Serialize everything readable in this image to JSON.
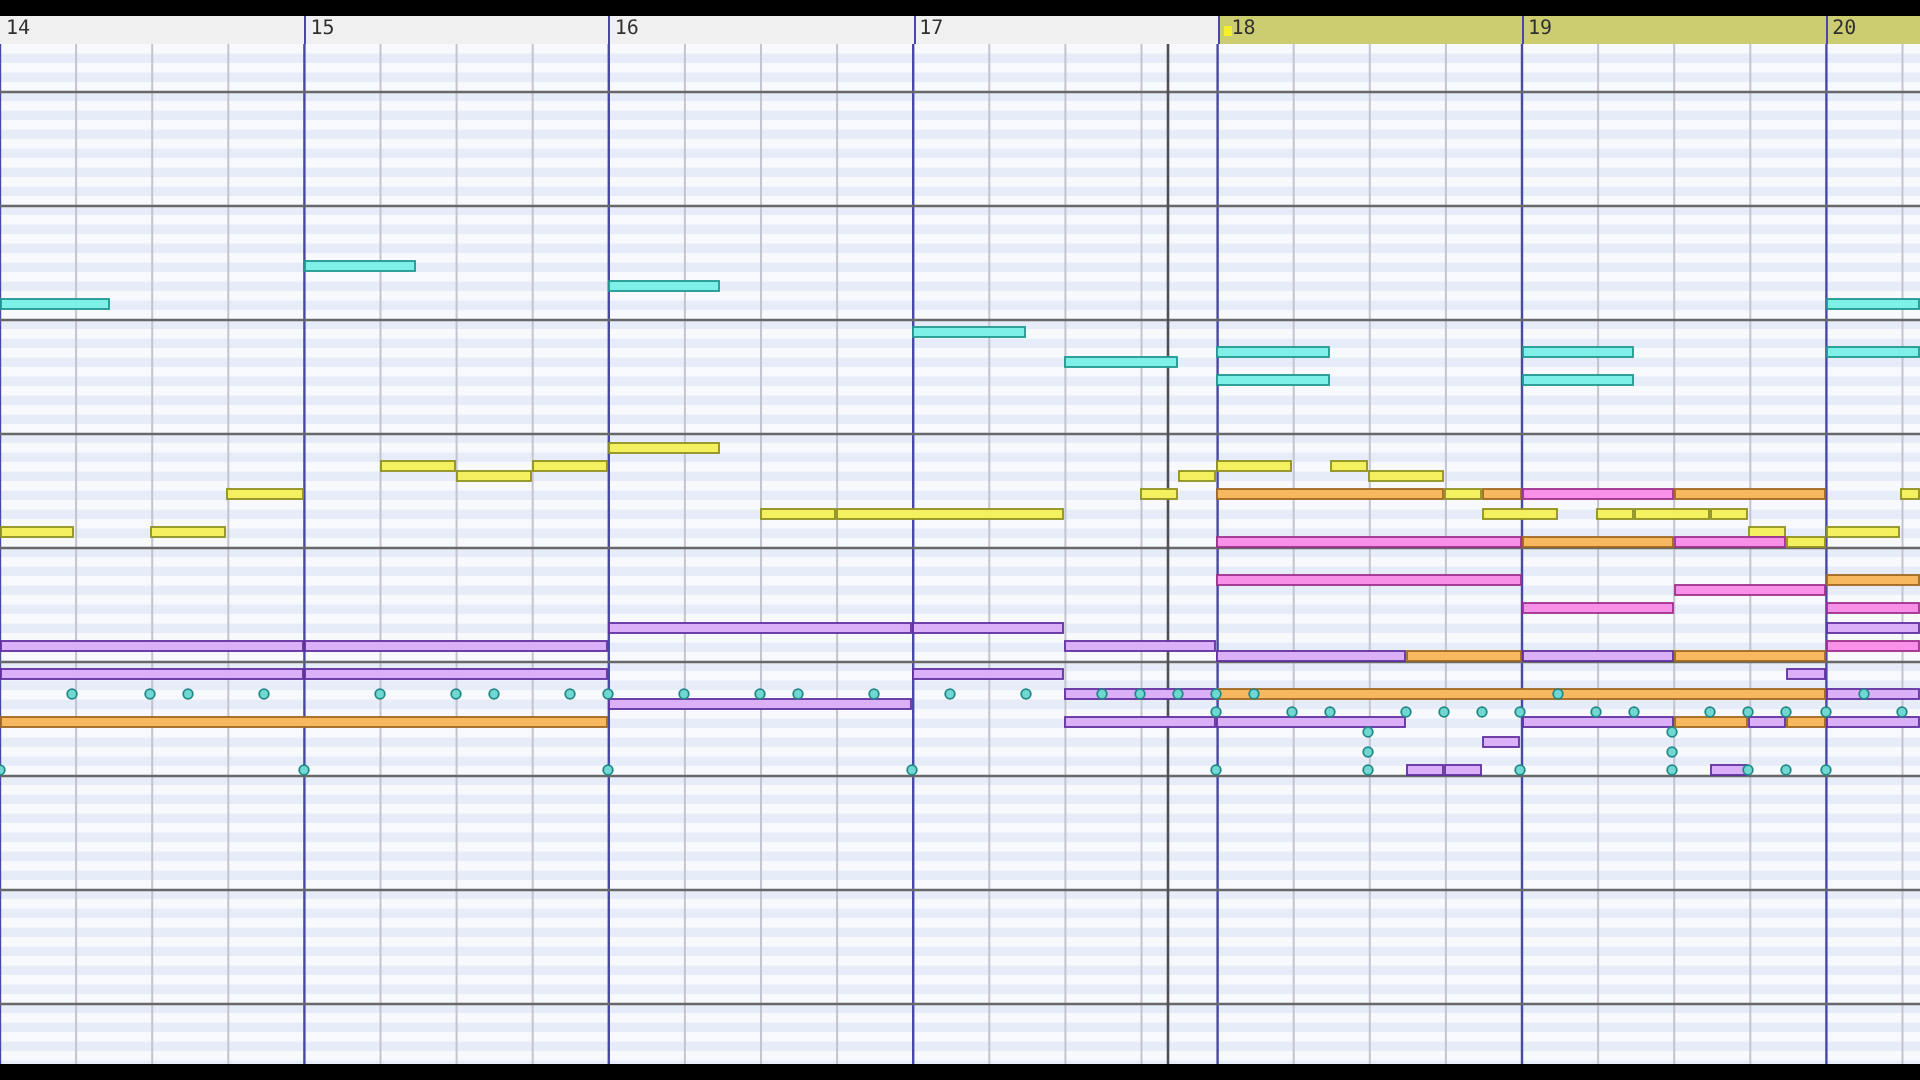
{
  "ruler": {
    "measures": [
      {
        "label": "14",
        "selected": false,
        "marker": false
      },
      {
        "label": "15",
        "selected": false,
        "marker": false
      },
      {
        "label": "16",
        "selected": false,
        "marker": false
      },
      {
        "label": "17",
        "selected": false,
        "marker": false
      },
      {
        "label": "18",
        "selected": true,
        "marker": true
      },
      {
        "label": "19",
        "selected": true,
        "marker": false
      },
      {
        "label": "20",
        "selected": true,
        "marker": false
      }
    ]
  }
}
